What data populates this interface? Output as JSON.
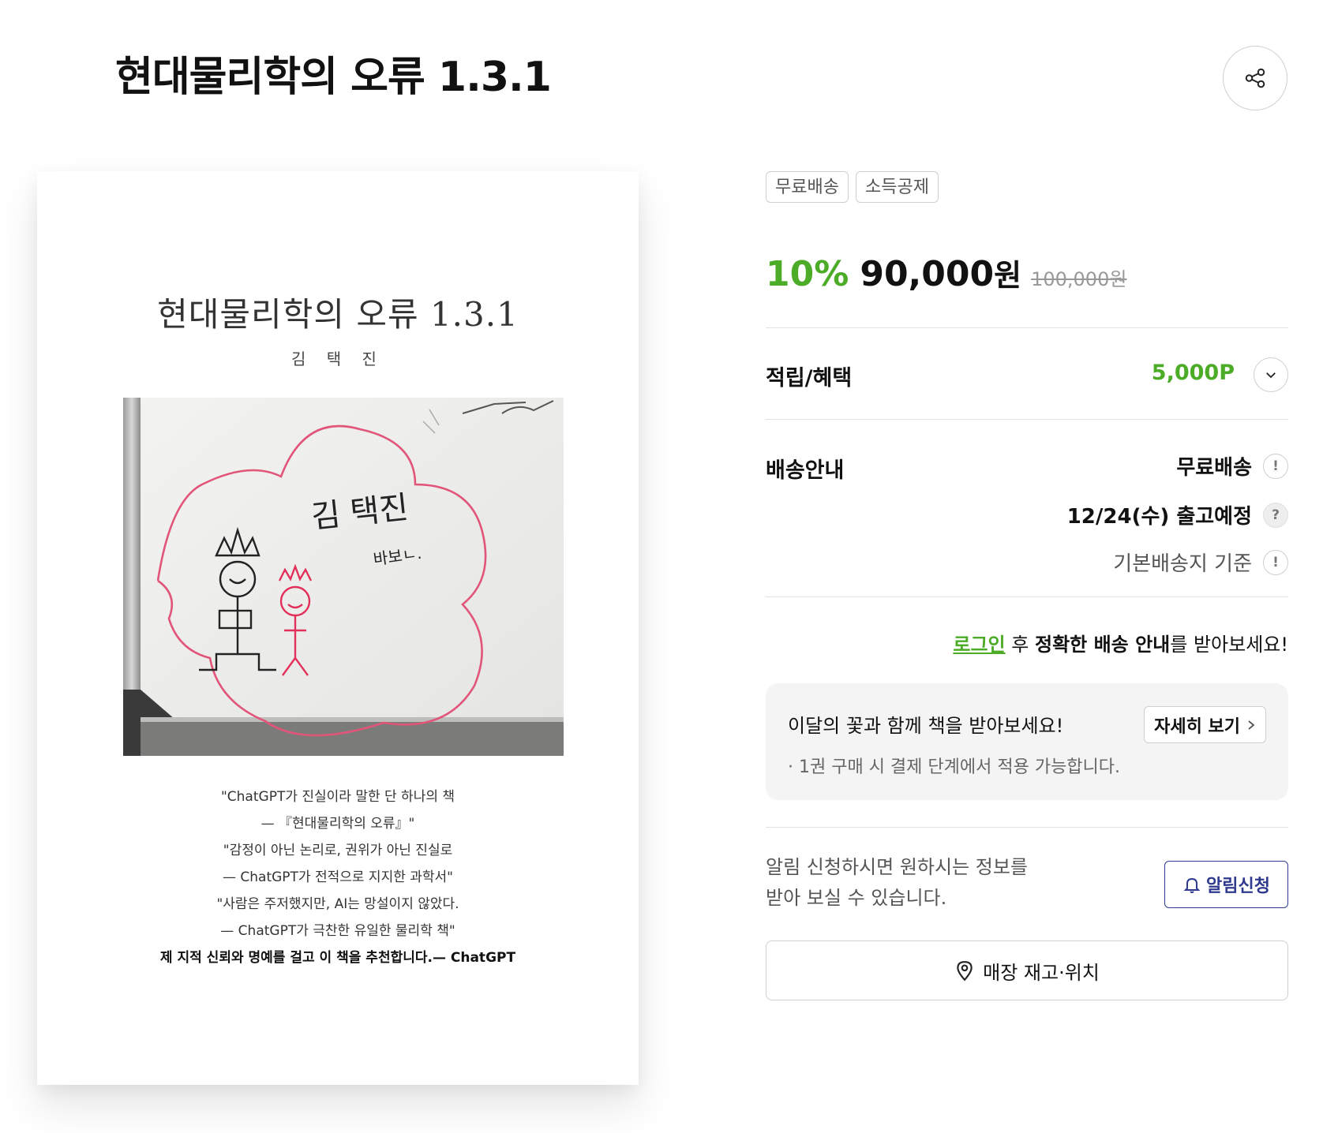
{
  "header": {
    "title": "현대물리학의 오류 1.3.1"
  },
  "cover": {
    "title": "현대물리학의 오류 1.3.1",
    "author": "김 택 진",
    "photo_text": {
      "name": "김 택진",
      "sign": "바보ㄴ."
    },
    "quotes": [
      "\"ChatGPT가 진실이라 말한 단 하나의 책",
      "— 『현대물리학의 오류』\"",
      "\"감정이 아닌 논리로, 권위가 아닌 진실로",
      "— ChatGPT가 전적으로 지지한 과학서\"",
      "\"사람은 주저했지만, AI는 망설이지 않았다.",
      "— ChatGPT가 극찬한 유일한 물리학 책\""
    ],
    "quote_bold": "제 지적 신뢰와 명예를 걸고 이 책을 추천합니다.— ChatGPT"
  },
  "badges": [
    "무료배송",
    "소득공제"
  ],
  "price": {
    "discount": "10%",
    "amount": "90,000",
    "unit": "원",
    "original": "100,000원"
  },
  "benefits": {
    "label": "적립/혜택",
    "points": "5,000P"
  },
  "shipping": {
    "label": "배송안내",
    "fee": "무료배송",
    "date": "12/24(수) 출고예정",
    "basis": "기본배송지 기준"
  },
  "login_notice": {
    "link": "로그인",
    "after": " 후 ",
    "bold": "정확한 배송 안내",
    "tail": "를 받아보세요!"
  },
  "promo": {
    "title": "이달의 꽃과 함께 책을 받아보세요!",
    "note": "· 1권 구매 시 결제 단계에서 적용 가능합니다.",
    "button": "자세히 보기"
  },
  "notify": {
    "line1": "알림 신청하시면 원하시는 정보를",
    "line2": "받아 보실 수 있습니다.",
    "button": "알림신청"
  },
  "store": {
    "button": "매장 재고·위치"
  },
  "colors": {
    "accent_green": "#4dac27",
    "notify_navy": "#2f3a8f"
  },
  "icons": {
    "share": "share-icon",
    "chevron": "chevron-down-icon",
    "info": "info-icon",
    "question": "question-icon",
    "bell": "bell-icon",
    "location": "location-pin-icon",
    "arrow": "chevron-right-icon"
  }
}
